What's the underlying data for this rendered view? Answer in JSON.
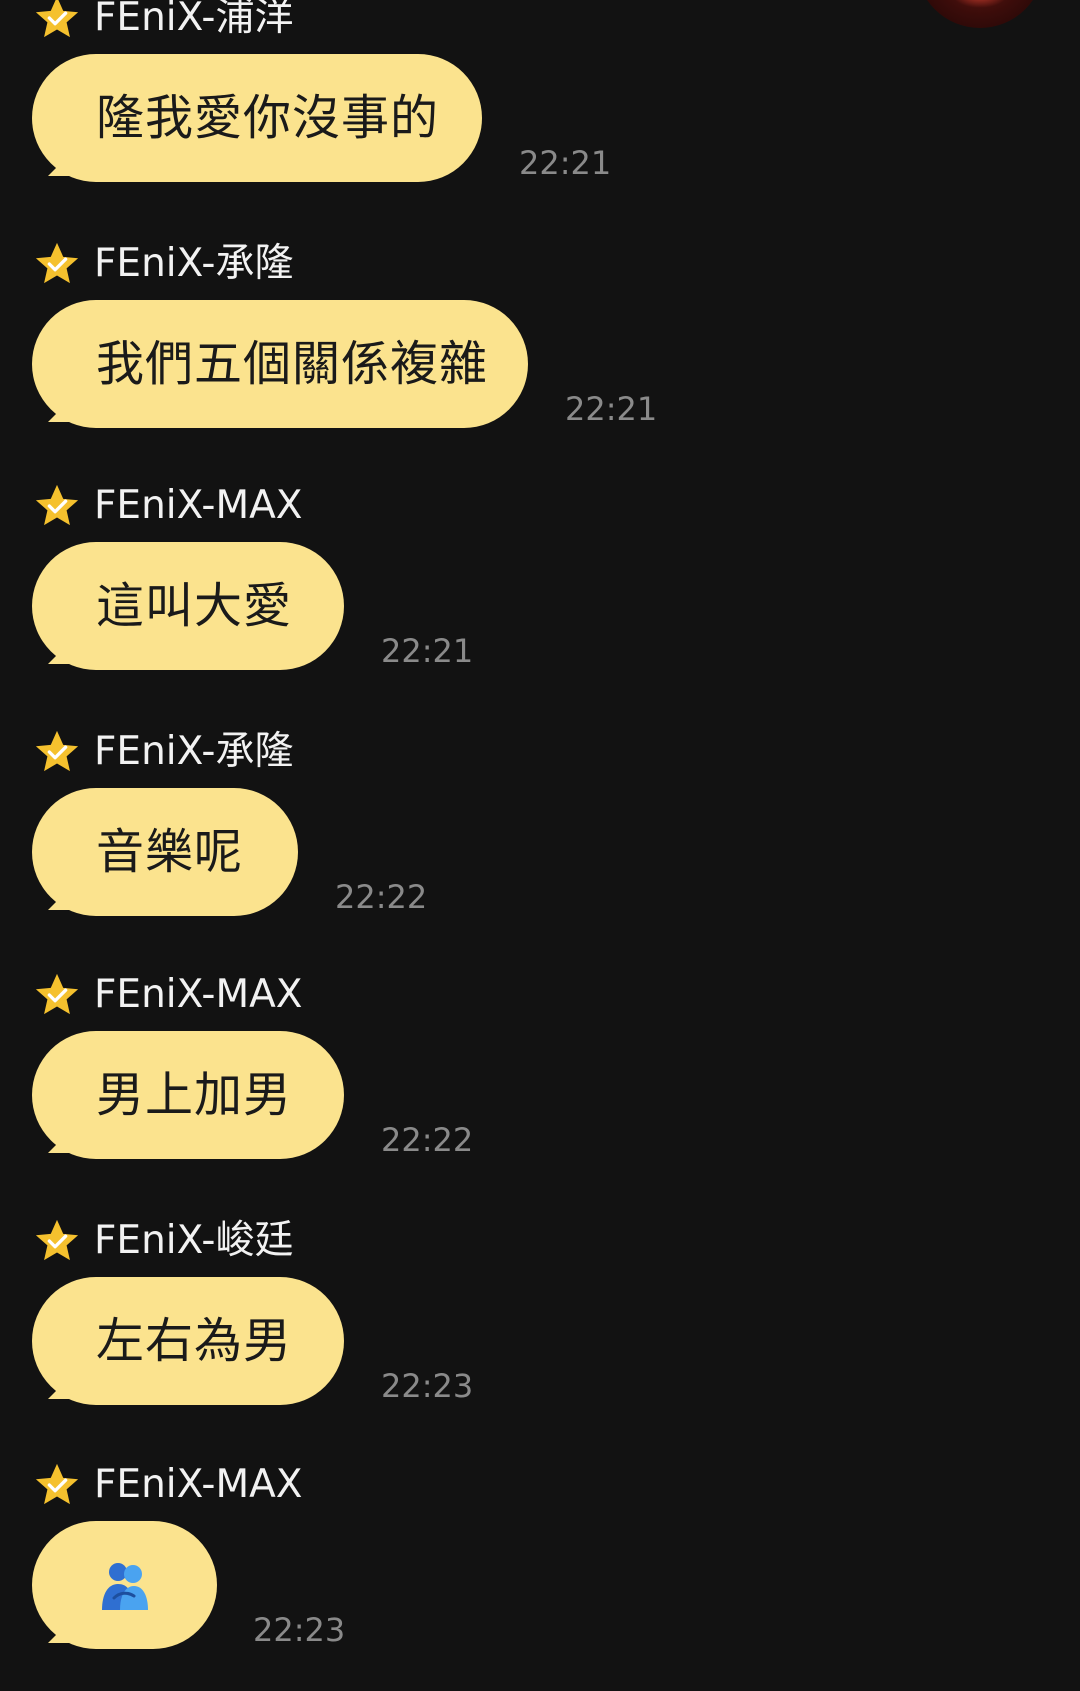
{
  "colors": {
    "background": "#121212",
    "bubble": "#fbe38e",
    "star": "#f5c12e",
    "sender_text": "#f2f2f2",
    "timestamp_text": "#8a8a8a"
  },
  "messages": [
    {
      "sender": "FEniX-浦洋",
      "text": "隆我愛你沒事的",
      "time": "22:21"
    },
    {
      "sender": "FEniX-承隆",
      "text": "我們五個關係複雜",
      "time": "22:21"
    },
    {
      "sender": "FEniX-MAX",
      "text": "這叫大愛",
      "time": "22:21"
    },
    {
      "sender": "FEniX-承隆",
      "text": "音樂呢",
      "time": "22:22"
    },
    {
      "sender": "FEniX-MAX",
      "text": "男上加男",
      "time": "22:22"
    },
    {
      "sender": "FEniX-峻廷",
      "text": "左右為男",
      "time": "22:23"
    },
    {
      "sender": "FEniX-MAX",
      "text": "",
      "emoji": "people-hugging-icon",
      "time": "22:23"
    }
  ]
}
